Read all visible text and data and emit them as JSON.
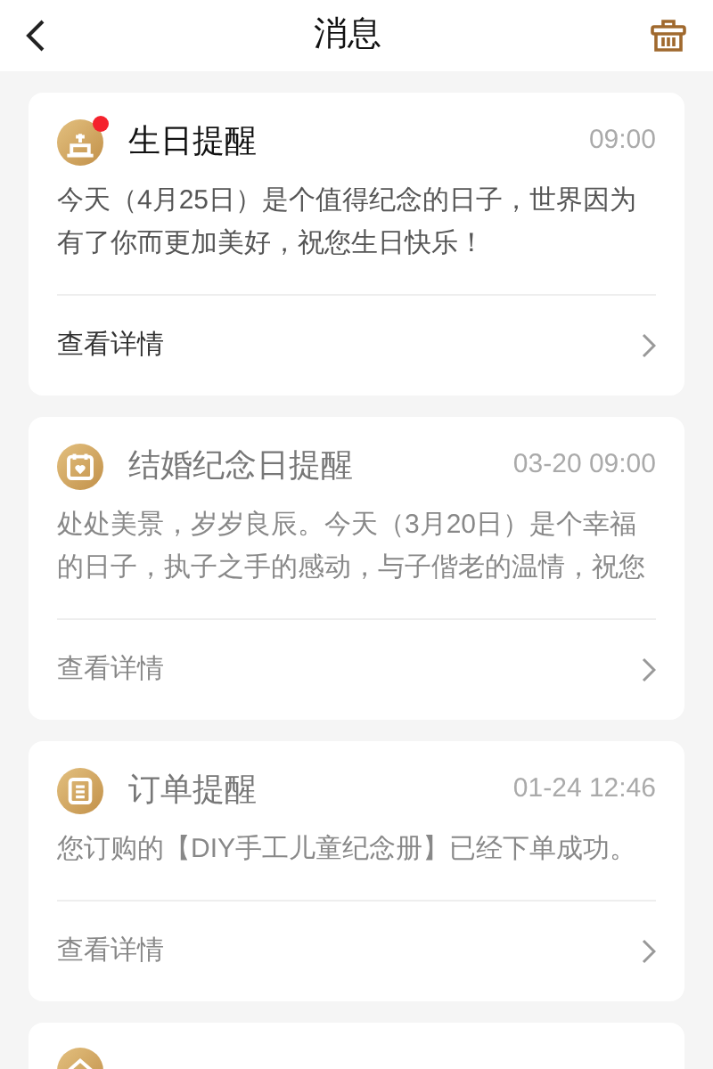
{
  "header": {
    "title": "消息"
  },
  "messages": [
    {
      "kind": "cake",
      "title": "生日提醒",
      "time": "09:00",
      "unread": true,
      "body": "今天（4月25日）是个值得纪念的日子，世界因为有了你而更加美好，祝您生日快乐！",
      "link": "查看详情"
    },
    {
      "kind": "calendar",
      "title": "结婚纪念日提醒",
      "time": "03-20 09:00",
      "unread": false,
      "body": "处处美景，岁岁良辰。今天（3月20日）是个幸福的日子，执子之手的感动，与子偕老的温情，祝您",
      "link": "查看详情"
    },
    {
      "kind": "document",
      "title": "订单提醒",
      "time": "01-24 12:46",
      "unread": false,
      "body": "您订购的【DIY手工儿童纪念册】已经下单成功。",
      "link": "查看详情"
    },
    {
      "kind": "house",
      "unread": false
    }
  ]
}
